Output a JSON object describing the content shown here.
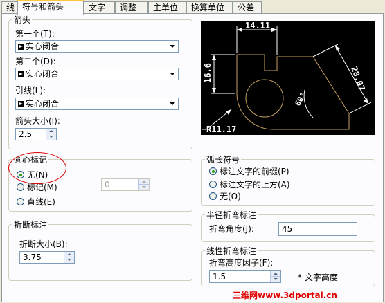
{
  "tabs": [
    "线",
    "符号和箭头",
    "文字",
    "调整",
    "主单位",
    "换算单位",
    "公差"
  ],
  "arrowheads": {
    "title": "箭头",
    "first_label": "第一个(T):",
    "first_value": "实心闭合",
    "second_label": "第二个(D):",
    "second_value": "实心闭合",
    "leader_label": "引线(L):",
    "leader_value": "实心闭合",
    "size_label": "箭头大小(I):",
    "size_value": "2.5"
  },
  "center_marks": {
    "title": "圆心标记",
    "options": [
      "无(N)",
      "标记(M)",
      "直线(E)"
    ],
    "selected_index": 0,
    "size_value": "0"
  },
  "break": {
    "title": "折断标注",
    "size_label": "折断大小(B):",
    "size_value": "3.75"
  },
  "arc_length": {
    "title": "弧长符号",
    "options": [
      "标注文字的前缀(P)",
      "标注文字的上方(A)",
      "无(O)"
    ],
    "selected_index": 0
  },
  "radius_jog": {
    "title": "半径折弯标注",
    "angle_label": "折弯角度(J):",
    "angle_value": "45"
  },
  "linear_jog": {
    "title": "线性折弯标注",
    "factor_label": "折弯高度因子(F):",
    "factor_value": "1.5",
    "unit_label": "* 文字高度"
  },
  "preview": {
    "dim_top": "14.11",
    "dim_left": "16.6",
    "dim_right": "28.07",
    "dim_angle": "60°",
    "dim_radius": "R11.17"
  },
  "watermark": "三维网www.3dportal.cn",
  "colors": {
    "preview_bg": "#000000",
    "preview_dims": "#ffffff",
    "preview_geometry": "#c8a060",
    "annotation_circle": "#e00000",
    "radio_selected": "#21a121"
  }
}
